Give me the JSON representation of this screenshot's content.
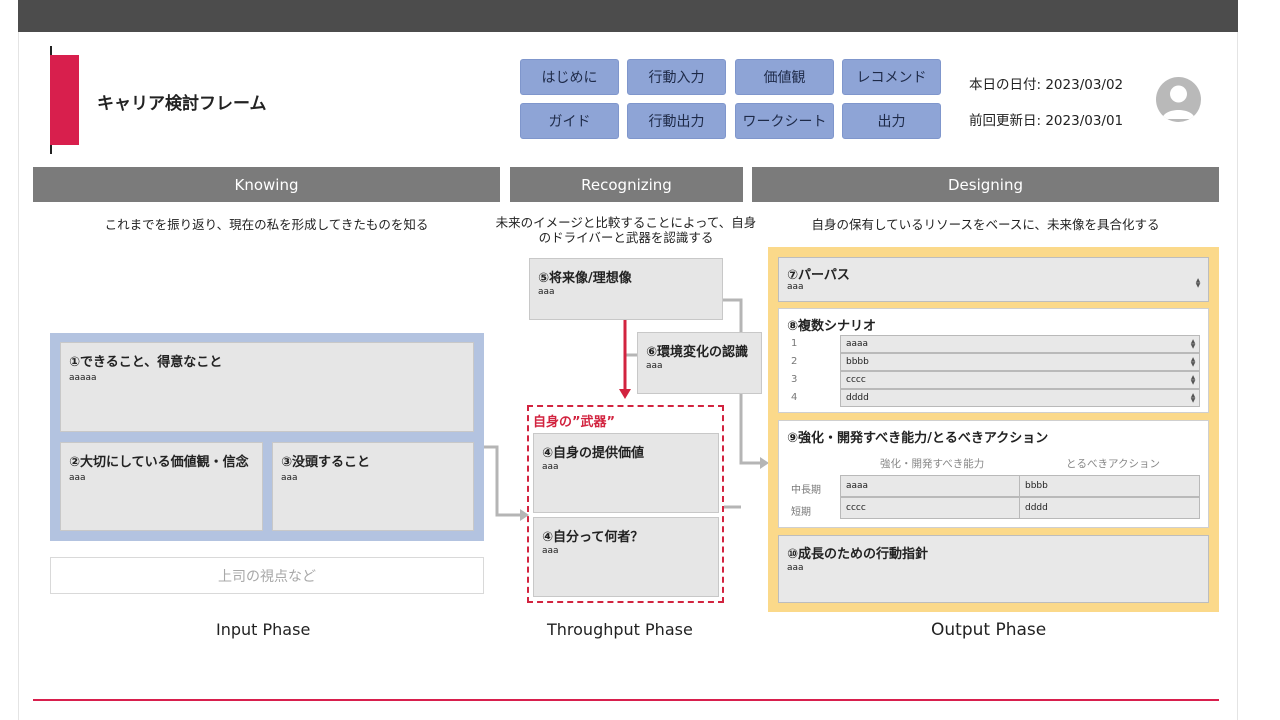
{
  "header": {
    "app_title": "キャリア検討フレーム",
    "nav_row1": [
      "はじめに",
      "行動入力",
      "価値観",
      "レコメンド"
    ],
    "nav_row2": [
      "ガイド",
      "行動出力",
      "ワークシート",
      "出力"
    ],
    "today_date": "本日の日付: 2023/03/02",
    "last_updated": "前回更新日: 2023/03/01"
  },
  "phases": {
    "knowing": {
      "header": "Knowing",
      "description": "これまでを振り返り、現在の私を形成してきたものを知る"
    },
    "recognizing": {
      "header": "Recognizing",
      "description_line1": "未来のイメージと比較することによって、自身",
      "description_line2": "のドライバーと武器を認識する"
    },
    "designing": {
      "header": "Designing",
      "description": "自身の保有しているリソースをベースに、未来像を具合化する"
    }
  },
  "input": {
    "card1": {
      "title": "①できること、得意なこと",
      "value": "aaaaa"
    },
    "card2": {
      "title": "②大切にしている価値観・信念",
      "value": "aaa"
    },
    "card3": {
      "title": "③没頭すること",
      "value": "aaa"
    },
    "placeholder": "上司の視点など",
    "phase_label": "Input Phase"
  },
  "throughput": {
    "future_image": {
      "title": "⑤将来像/理想像",
      "value": "aaa"
    },
    "env_change": {
      "title": "⑥環境変化の認識",
      "value": "aaa"
    },
    "weapon_title": "自身の”武器”",
    "provided_value": {
      "title": "④自身の提供価値",
      "value": "aaa"
    },
    "who_am_i": {
      "title": "④自分って何者？",
      "value": "aaa"
    },
    "phase_label": "Throughput Phase"
  },
  "output": {
    "purpose": {
      "title": "⑦パーパス",
      "value": "aaa"
    },
    "scenarios": {
      "title": "⑧複数シナリオ",
      "rows": [
        {
          "num": "1",
          "value": "aaaa"
        },
        {
          "num": "2",
          "value": "bbbb"
        },
        {
          "num": "3",
          "value": "cccc"
        },
        {
          "num": "4",
          "value": "dddd"
        }
      ]
    },
    "abilities": {
      "title": "⑨強化・開発すべき能力/とるべきアクション",
      "col1": "強化・開発すべき能力",
      "col2": "とるべきアクション",
      "rows": [
        {
          "term": "中長期",
          "ability": "aaaa",
          "action": "bbbb"
        },
        {
          "term": "短期",
          "ability": "cccc",
          "action": "dddd"
        }
      ]
    },
    "growth": {
      "title": "⑩成長のための行動指針",
      "value": "aaa"
    },
    "phase_label": "Output Phase"
  },
  "colors": {
    "accent": "#d81f4d",
    "nav_button": "#8ea4d6",
    "input_area": "#b3c3e0",
    "output_area": "#fbd98a",
    "phase_header": "#7b7b7b"
  }
}
